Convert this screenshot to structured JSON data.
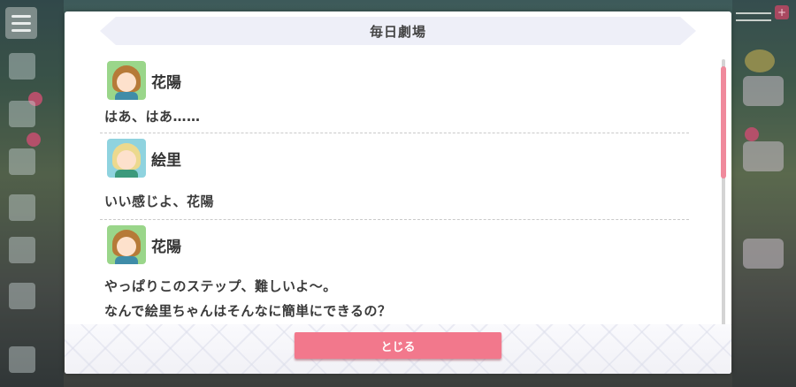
{
  "dialog": {
    "title": "毎日劇場",
    "close_label": "とじる"
  },
  "entries": [
    {
      "speaker": "花陽",
      "avatar_color": "green",
      "lines": [
        "はあ、はあ……"
      ]
    },
    {
      "speaker": "絵里",
      "avatar_color": "cyan",
      "lines": [
        "いい感じよ、花陽"
      ]
    },
    {
      "speaker": "花陽",
      "avatar_color": "green",
      "lines": [
        "やっぱりこのステップ、難しいよ〜。",
        "なんで絵里ちゃんはそんなに簡単にできるの？"
      ]
    }
  ],
  "colors": {
    "accent": "#f2788c",
    "scroll_thumb": "#f08a9c",
    "title_bar": "#eeeff8"
  },
  "icons": {
    "menu": "hamburger-menu-icon",
    "gauge": "plus-icon"
  }
}
